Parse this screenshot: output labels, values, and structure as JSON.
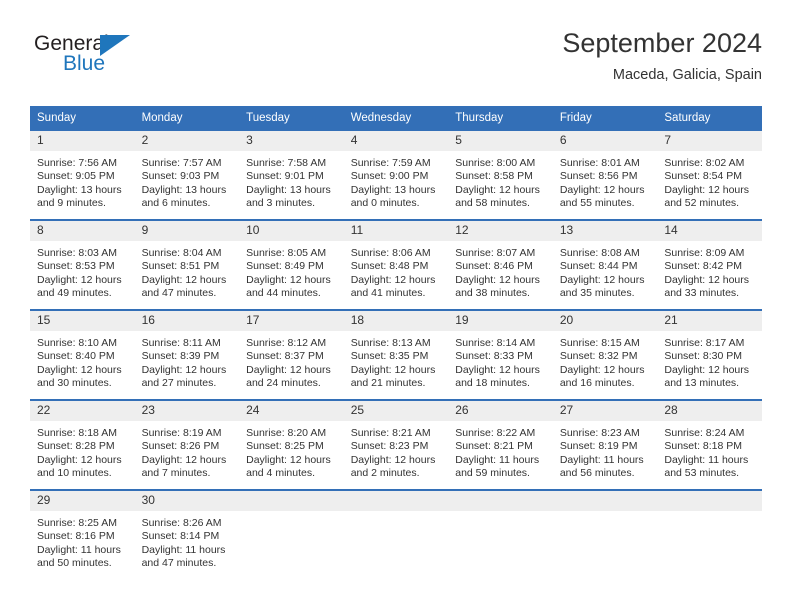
{
  "brand": {
    "word_one": "General",
    "word_two": "Blue",
    "accent_color": "#1f76bc"
  },
  "header": {
    "title": "September 2024",
    "subtitle": "Maceda, Galicia, Spain"
  },
  "theme": {
    "header_blue": "#336fb7",
    "daynum_band": "#eeeeee",
    "text": "#333333"
  },
  "weekday_headers": [
    "Sunday",
    "Monday",
    "Tuesday",
    "Wednesday",
    "Thursday",
    "Friday",
    "Saturday"
  ],
  "weeks": [
    [
      {
        "day": "1",
        "sunrise": "Sunrise: 7:56 AM",
        "sunset": "Sunset: 9:05 PM",
        "daylight_line1": "Daylight: 13 hours",
        "daylight_line2": "and 9 minutes."
      },
      {
        "day": "2",
        "sunrise": "Sunrise: 7:57 AM",
        "sunset": "Sunset: 9:03 PM",
        "daylight_line1": "Daylight: 13 hours",
        "daylight_line2": "and 6 minutes."
      },
      {
        "day": "3",
        "sunrise": "Sunrise: 7:58 AM",
        "sunset": "Sunset: 9:01 PM",
        "daylight_line1": "Daylight: 13 hours",
        "daylight_line2": "and 3 minutes."
      },
      {
        "day": "4",
        "sunrise": "Sunrise: 7:59 AM",
        "sunset": "Sunset: 9:00 PM",
        "daylight_line1": "Daylight: 13 hours",
        "daylight_line2": "and 0 minutes."
      },
      {
        "day": "5",
        "sunrise": "Sunrise: 8:00 AM",
        "sunset": "Sunset: 8:58 PM",
        "daylight_line1": "Daylight: 12 hours",
        "daylight_line2": "and 58 minutes."
      },
      {
        "day": "6",
        "sunrise": "Sunrise: 8:01 AM",
        "sunset": "Sunset: 8:56 PM",
        "daylight_line1": "Daylight: 12 hours",
        "daylight_line2": "and 55 minutes."
      },
      {
        "day": "7",
        "sunrise": "Sunrise: 8:02 AM",
        "sunset": "Sunset: 8:54 PM",
        "daylight_line1": "Daylight: 12 hours",
        "daylight_line2": "and 52 minutes."
      }
    ],
    [
      {
        "day": "8",
        "sunrise": "Sunrise: 8:03 AM",
        "sunset": "Sunset: 8:53 PM",
        "daylight_line1": "Daylight: 12 hours",
        "daylight_line2": "and 49 minutes."
      },
      {
        "day": "9",
        "sunrise": "Sunrise: 8:04 AM",
        "sunset": "Sunset: 8:51 PM",
        "daylight_line1": "Daylight: 12 hours",
        "daylight_line2": "and 47 minutes."
      },
      {
        "day": "10",
        "sunrise": "Sunrise: 8:05 AM",
        "sunset": "Sunset: 8:49 PM",
        "daylight_line1": "Daylight: 12 hours",
        "daylight_line2": "and 44 minutes."
      },
      {
        "day": "11",
        "sunrise": "Sunrise: 8:06 AM",
        "sunset": "Sunset: 8:48 PM",
        "daylight_line1": "Daylight: 12 hours",
        "daylight_line2": "and 41 minutes."
      },
      {
        "day": "12",
        "sunrise": "Sunrise: 8:07 AM",
        "sunset": "Sunset: 8:46 PM",
        "daylight_line1": "Daylight: 12 hours",
        "daylight_line2": "and 38 minutes."
      },
      {
        "day": "13",
        "sunrise": "Sunrise: 8:08 AM",
        "sunset": "Sunset: 8:44 PM",
        "daylight_line1": "Daylight: 12 hours",
        "daylight_line2": "and 35 minutes."
      },
      {
        "day": "14",
        "sunrise": "Sunrise: 8:09 AM",
        "sunset": "Sunset: 8:42 PM",
        "daylight_line1": "Daylight: 12 hours",
        "daylight_line2": "and 33 minutes."
      }
    ],
    [
      {
        "day": "15",
        "sunrise": "Sunrise: 8:10 AM",
        "sunset": "Sunset: 8:40 PM",
        "daylight_line1": "Daylight: 12 hours",
        "daylight_line2": "and 30 minutes."
      },
      {
        "day": "16",
        "sunrise": "Sunrise: 8:11 AM",
        "sunset": "Sunset: 8:39 PM",
        "daylight_line1": "Daylight: 12 hours",
        "daylight_line2": "and 27 minutes."
      },
      {
        "day": "17",
        "sunrise": "Sunrise: 8:12 AM",
        "sunset": "Sunset: 8:37 PM",
        "daylight_line1": "Daylight: 12 hours",
        "daylight_line2": "and 24 minutes."
      },
      {
        "day": "18",
        "sunrise": "Sunrise: 8:13 AM",
        "sunset": "Sunset: 8:35 PM",
        "daylight_line1": "Daylight: 12 hours",
        "daylight_line2": "and 21 minutes."
      },
      {
        "day": "19",
        "sunrise": "Sunrise: 8:14 AM",
        "sunset": "Sunset: 8:33 PM",
        "daylight_line1": "Daylight: 12 hours",
        "daylight_line2": "and 18 minutes."
      },
      {
        "day": "20",
        "sunrise": "Sunrise: 8:15 AM",
        "sunset": "Sunset: 8:32 PM",
        "daylight_line1": "Daylight: 12 hours",
        "daylight_line2": "and 16 minutes."
      },
      {
        "day": "21",
        "sunrise": "Sunrise: 8:17 AM",
        "sunset": "Sunset: 8:30 PM",
        "daylight_line1": "Daylight: 12 hours",
        "daylight_line2": "and 13 minutes."
      }
    ],
    [
      {
        "day": "22",
        "sunrise": "Sunrise: 8:18 AM",
        "sunset": "Sunset: 8:28 PM",
        "daylight_line1": "Daylight: 12 hours",
        "daylight_line2": "and 10 minutes."
      },
      {
        "day": "23",
        "sunrise": "Sunrise: 8:19 AM",
        "sunset": "Sunset: 8:26 PM",
        "daylight_line1": "Daylight: 12 hours",
        "daylight_line2": "and 7 minutes."
      },
      {
        "day": "24",
        "sunrise": "Sunrise: 8:20 AM",
        "sunset": "Sunset: 8:25 PM",
        "daylight_line1": "Daylight: 12 hours",
        "daylight_line2": "and 4 minutes."
      },
      {
        "day": "25",
        "sunrise": "Sunrise: 8:21 AM",
        "sunset": "Sunset: 8:23 PM",
        "daylight_line1": "Daylight: 12 hours",
        "daylight_line2": "and 2 minutes."
      },
      {
        "day": "26",
        "sunrise": "Sunrise: 8:22 AM",
        "sunset": "Sunset: 8:21 PM",
        "daylight_line1": "Daylight: 11 hours",
        "daylight_line2": "and 59 minutes."
      },
      {
        "day": "27",
        "sunrise": "Sunrise: 8:23 AM",
        "sunset": "Sunset: 8:19 PM",
        "daylight_line1": "Daylight: 11 hours",
        "daylight_line2": "and 56 minutes."
      },
      {
        "day": "28",
        "sunrise": "Sunrise: 8:24 AM",
        "sunset": "Sunset: 8:18 PM",
        "daylight_line1": "Daylight: 11 hours",
        "daylight_line2": "and 53 minutes."
      }
    ],
    [
      {
        "day": "29",
        "sunrise": "Sunrise: 8:25 AM",
        "sunset": "Sunset: 8:16 PM",
        "daylight_line1": "Daylight: 11 hours",
        "daylight_line2": "and 50 minutes."
      },
      {
        "day": "30",
        "sunrise": "Sunrise: 8:26 AM",
        "sunset": "Sunset: 8:14 PM",
        "daylight_line1": "Daylight: 11 hours",
        "daylight_line2": "and 47 minutes."
      },
      {
        "day": "",
        "sunrise": "",
        "sunset": "",
        "daylight_line1": "",
        "daylight_line2": ""
      },
      {
        "day": "",
        "sunrise": "",
        "sunset": "",
        "daylight_line1": "",
        "daylight_line2": ""
      },
      {
        "day": "",
        "sunrise": "",
        "sunset": "",
        "daylight_line1": "",
        "daylight_line2": ""
      },
      {
        "day": "",
        "sunrise": "",
        "sunset": "",
        "daylight_line1": "",
        "daylight_line2": ""
      },
      {
        "day": "",
        "sunrise": "",
        "sunset": "",
        "daylight_line1": "",
        "daylight_line2": ""
      }
    ]
  ]
}
